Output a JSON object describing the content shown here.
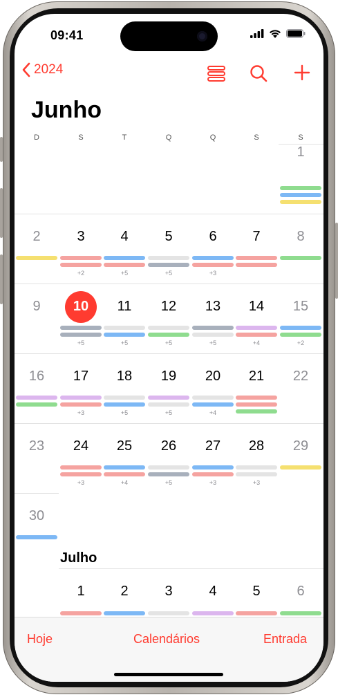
{
  "status": {
    "time": "09:41",
    "icons": [
      "cellular-signal-icon",
      "wifi-icon",
      "battery-icon"
    ]
  },
  "nav": {
    "back_label": "2024",
    "icons": [
      "list-view-icon",
      "search-icon",
      "add-icon"
    ]
  },
  "month_title": "Junho",
  "weekdays": [
    "D",
    "S",
    "T",
    "Q",
    "Q",
    "S",
    "S"
  ],
  "next_month_label": "Julho",
  "colors": {
    "accent": "#ff3b30",
    "red": "#f5a3a0",
    "blue": "#7db8f5",
    "green": "#8fdc8f",
    "yellow": "#f5e070",
    "purple": "#dcb6ee",
    "gray": "#e4e4e4",
    "slate": "#a8b0bc"
  },
  "weeks": [
    {
      "days": [
        {
          "num": ""
        },
        {
          "num": ""
        },
        {
          "num": ""
        },
        {
          "num": ""
        },
        {
          "num": ""
        },
        {
          "num": ""
        },
        {
          "num": "1",
          "weekend": true,
          "bars": [
            "green",
            "blue",
            "yellow"
          ],
          "more": ""
        }
      ]
    },
    {
      "days": [
        {
          "num": "2",
          "weekend": true,
          "bars": [
            "yellow"
          ],
          "more": ""
        },
        {
          "num": "3",
          "bars": [
            "red",
            "red"
          ],
          "more": "+2"
        },
        {
          "num": "4",
          "bars": [
            "blue",
            "red"
          ],
          "more": "+5"
        },
        {
          "num": "5",
          "bars": [
            "gray",
            "slate"
          ],
          "more": "+5"
        },
        {
          "num": "6",
          "bars": [
            "blue",
            "red"
          ],
          "more": "+3"
        },
        {
          "num": "7",
          "bars": [
            "red",
            "red"
          ],
          "more": ""
        },
        {
          "num": "8",
          "weekend": true,
          "bars": [
            "green"
          ],
          "more": ""
        }
      ]
    },
    {
      "days": [
        {
          "num": "9",
          "weekend": true,
          "bars": [],
          "more": ""
        },
        {
          "num": "10",
          "today": true,
          "bars": [
            "slate",
            "slate"
          ],
          "more": "+5"
        },
        {
          "num": "11",
          "bars": [
            "gray",
            "blue"
          ],
          "more": "+5"
        },
        {
          "num": "12",
          "bars": [
            "gray",
            "green"
          ],
          "more": "+5"
        },
        {
          "num": "13",
          "bars": [
            "slate",
            "gray"
          ],
          "more": "+5"
        },
        {
          "num": "14",
          "bars": [
            "purple",
            "red"
          ],
          "more": "+4"
        },
        {
          "num": "15",
          "weekend": true,
          "bars": [
            "blue",
            "green"
          ],
          "more": "+2"
        }
      ]
    },
    {
      "days": [
        {
          "num": "16",
          "weekend": true,
          "bars": [
            "purple",
            "green"
          ],
          "more": ""
        },
        {
          "num": "17",
          "bars": [
            "purple",
            "red"
          ],
          "more": "+3"
        },
        {
          "num": "18",
          "bars": [
            "gray",
            "blue"
          ],
          "more": "+5"
        },
        {
          "num": "19",
          "bars": [
            "purple",
            "gray"
          ],
          "more": "+5"
        },
        {
          "num": "20",
          "bars": [
            "gray",
            "blue"
          ],
          "more": "+4"
        },
        {
          "num": "21",
          "bars": [
            "red",
            "red",
            "green"
          ],
          "more": ""
        },
        {
          "num": "22",
          "weekend": true,
          "bars": [],
          "more": ""
        }
      ]
    },
    {
      "days": [
        {
          "num": "23",
          "weekend": true,
          "bars": [],
          "more": ""
        },
        {
          "num": "24",
          "bars": [
            "red",
            "red"
          ],
          "more": "+3"
        },
        {
          "num": "25",
          "bars": [
            "blue",
            "red"
          ],
          "more": "+4"
        },
        {
          "num": "26",
          "bars": [
            "gray",
            "slate"
          ],
          "more": "+5"
        },
        {
          "num": "27",
          "bars": [
            "blue",
            "red"
          ],
          "more": "+3"
        },
        {
          "num": "28",
          "bars": [
            "gray",
            "gray"
          ],
          "more": "+3"
        },
        {
          "num": "29",
          "weekend": true,
          "bars": [
            "yellow"
          ],
          "more": ""
        }
      ]
    },
    {
      "days": [
        {
          "num": "30",
          "weekend": true,
          "bars": [
            "blue"
          ],
          "more": ""
        }
      ]
    }
  ],
  "july_week": [
    {
      "num": ""
    },
    {
      "num": "1",
      "bars": [
        "red"
      ]
    },
    {
      "num": "2",
      "bars": [
        "blue"
      ]
    },
    {
      "num": "3",
      "bars": [
        "gray"
      ]
    },
    {
      "num": "4",
      "bars": [
        "purple"
      ]
    },
    {
      "num": "5",
      "bars": [
        "red"
      ]
    },
    {
      "num": "6",
      "weekend": true,
      "bars": [
        "green"
      ]
    }
  ],
  "toolbar": {
    "today": "Hoje",
    "calendars": "Calendários",
    "inbox": "Entrada"
  }
}
